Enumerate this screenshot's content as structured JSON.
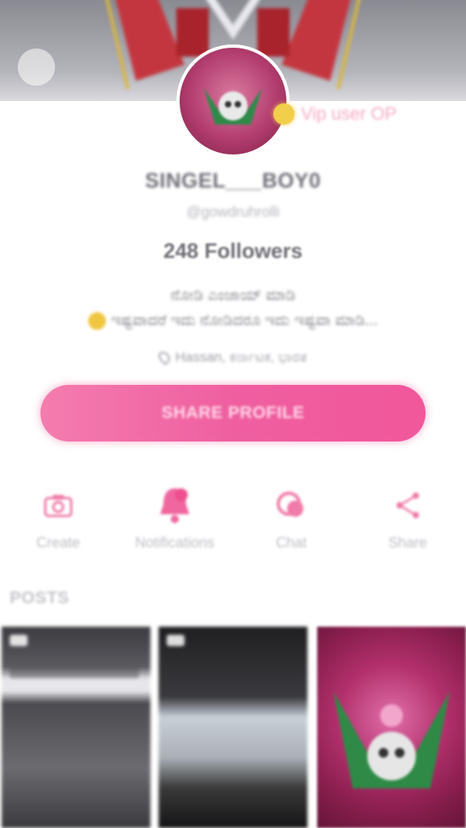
{
  "profile": {
    "username": "SINGEL___BOY0",
    "handle": "@gowdruhrolli",
    "vip_label": "Vip user OP",
    "followers": "248 Followers",
    "bio_line1": "ನೋಡಿ ಎಂಜಾಯ್ ಮಾಡಿ",
    "bio_line2": "ಇಷ್ಟವಾದರೆ ಇದು ನೋಡಿದರೂ ಇದು ಇಷ್ಟವಾ ಮಾಡಿ...",
    "location": "Hassan, ಕರ್ನಾಟಕ, ಭಾರತ"
  },
  "share_profile_label": "SHARE PROFILE",
  "actions": [
    {
      "label": "Create",
      "icon": "camera-icon"
    },
    {
      "label": "Notifications",
      "icon": "bell-icon"
    },
    {
      "label": "Chat",
      "icon": "chat-icon"
    },
    {
      "label": "Share",
      "icon": "share-icon"
    }
  ],
  "posts_title": "POSTS",
  "colors": {
    "accent_pink": "#ef5fa0",
    "vip_gold": "#f2cf4a"
  }
}
